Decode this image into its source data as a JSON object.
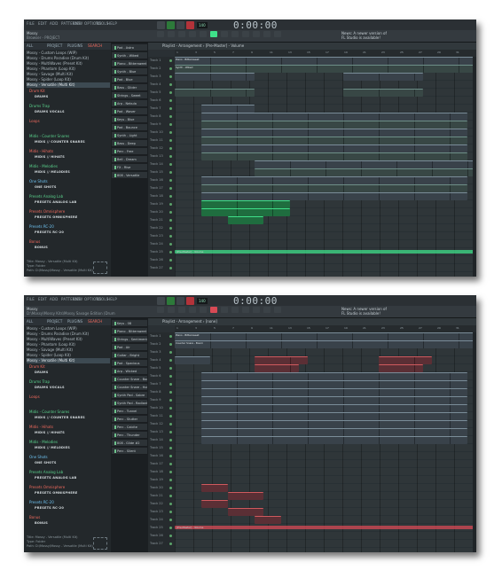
{
  "screenshots": [
    {
      "menu": [
        "FILE",
        "EDIT",
        "ADD",
        "PATTERNS",
        "VIEW",
        "OPTIONS",
        "TOOLS",
        "HELP"
      ],
      "title": "Mossy",
      "subtitle": "Browser - PROJECT",
      "time": "0:00:00",
      "pattern_selector": "Yeah - Starlight",
      "news": [
        "News: A newer version of",
        "FL Studio is available!"
      ],
      "browser_tabs": [
        "ALL",
        "PROJECT",
        "PLUGINS",
        "SEARCH"
      ],
      "files": [
        "Mossy - Custom Loops (WIP)",
        "Mossy - Drums Paradise (Drum Kit)",
        "Mossy - MultiWaves (Preset Kit)",
        "Mossy - Phantom (Loop Kit)",
        "Mossy - Savage (Multi Kit)",
        "Mossy - Spider (Loop Kit)",
        "Mossy - Versatile (Multi Kit)"
      ],
      "folders": [
        {
          "name": "Drum Kit",
          "tag": "DRUMS"
        },
        {
          "name": "Drums Trap",
          "tag": "DRUMS VOCALS"
        },
        {
          "name": "Loops",
          "tag": ""
        },
        {
          "name": "Midis - Counter Snares",
          "tag": "MIDIS // COUNTER SNARES"
        },
        {
          "name": "Midis - Hihats",
          "tag": "MIDIS // HIHATS"
        },
        {
          "name": "Midis - Melodies",
          "tag": "MIDIS // MELODIES"
        },
        {
          "name": "One Shots",
          "tag": "ONE SHOTS"
        },
        {
          "name": "Presets Analog Lab",
          "tag": "PRESETS ANALOG LAB"
        },
        {
          "name": "Presets Omnisphere",
          "tag": "PRESETS OMNISPHERE"
        },
        {
          "name": "Presets RC-20",
          "tag": "PRESETS RC-20"
        },
        {
          "name": "Bonus",
          "tag": "BONUS"
        }
      ],
      "info": [
        "Title: Mossy - Versatile (Multi Kit)",
        "Type: Folder",
        "Path: D:\\Mossy\\Mossy - Versatile (Multi Kit)"
      ],
      "channels": [
        "Pad - Astro",
        "Synth - Wiked",
        "Piano - Bittersweet",
        "Synth - Blue",
        "Pad - Blue",
        "Bass - Glider",
        "Strings - Sweet",
        "Arp - Nebula",
        "Pad - Waver",
        "Keys - Blue",
        "Pad - Bounce",
        "Synth - Light",
        "Bass - Deep",
        "Perc - Free",
        "Bell - Dream",
        "FX - Rise",
        "808 - Versatile"
      ],
      "playlist_title": "Playlist - Arrangement › [Pre-Master] - Volume",
      "ticks": [
        "1",
        "3",
        "5",
        "7",
        "9",
        "11",
        "13",
        "15",
        "17",
        "19",
        "21",
        "23",
        "25",
        "27",
        "29",
        "31"
      ],
      "tracks": [
        "Track 1",
        "Track 2",
        "Track 3",
        "Track 4",
        "Track 5",
        "Track 6",
        "Track 7",
        "Track 8",
        "Track 9",
        "Track 10",
        "Track 11",
        "Track 12",
        "Track 13",
        "Track 14",
        "Track 15",
        "Track 16",
        "Track 17",
        "Track 18",
        "Track 19",
        "Track 20",
        "Track 21",
        "Track 22",
        "Track 23",
        "Track 24",
        "Track 25",
        "Track 26",
        "Track 27"
      ],
      "clip_label_a": "Piano - Bittersweet",
      "clip_label_b": "Synth - Wiked",
      "automation_label": "[Pre-Master] - Volume",
      "accent": "#3fe08a"
    },
    {
      "menu": [
        "FILE",
        "EDIT",
        "ADD",
        "PATTERNS",
        "VIEW",
        "OPTIONS",
        "TOOLS",
        "HELP"
      ],
      "title": "Mossy",
      "subtitle": "D:\\Mossy\\Mossy Kits\\Mossy Savage Edition (Drum Kit)",
      "time": "0:00:00",
      "pattern_selector": "808 - Glide #2",
      "news": [
        "News: A newer version of",
        "FL Studio is available!"
      ],
      "browser_tabs": [
        "ALL",
        "PROJECT",
        "PLUGINS",
        "SEARCH"
      ],
      "files": [
        "Mossy - Custom Loops (WIP)",
        "Mossy - Drums Paradise (Drum Kit)",
        "Mossy - MultiWaves (Preset Kit)",
        "Mossy - Phantom (Loop Kit)",
        "Mossy - Savage (Multi Kit)",
        "Mossy - Spider (Loop Kit)",
        "Mossy - Versatile (Multi Kit)"
      ],
      "folders": [
        {
          "name": "Drum Kit",
          "tag": "DRUMS"
        },
        {
          "name": "Drums Trap",
          "tag": "DRUMS VOCALS"
        },
        {
          "name": "Loops",
          "tag": ""
        },
        {
          "name": "Midis - Counter Snares",
          "tag": "MIDIS // COUNTER SNARES"
        },
        {
          "name": "Midis - Hihats",
          "tag": "MIDIS // HIHATS"
        },
        {
          "name": "Midis - Melodies",
          "tag": "MIDIS // MELODIES"
        },
        {
          "name": "One Shots",
          "tag": "ONE SHOTS"
        },
        {
          "name": "Presets Analog Lab",
          "tag": "PRESETS ANALOG LAB"
        },
        {
          "name": "Presets Omnisphere",
          "tag": "PRESETS OMNISPHERE"
        },
        {
          "name": "Presets RC-20",
          "tag": "PRESETS RC-20"
        },
        {
          "name": "Bonus",
          "tag": "BONUS"
        }
      ],
      "info": [
        "Title: Mossy - Versatile (Multi Kit)",
        "Type: Folder",
        "Path: D:\\Mossy\\Mossy - Versatile (Multi Kit)"
      ],
      "channels": [
        "Keys - 08",
        "Piano - Bittersweet",
        "Strings - Sentiment",
        "Pad - Air",
        "Guitar - Bright",
        "Pad - Spacious",
        "Arp - Wicked",
        "Counter Snare - Boom",
        "Counter Snare - Hollow",
        "Synth Pad - Sabre",
        "Synth Pad - Radiant",
        "Perc - Tunnel",
        "Perc - Stutter",
        "Perc - Calcite",
        "Perc - Thunder",
        "808 - Glide #2",
        "Perc - Silent"
      ],
      "playlist_title": "Playlist - Arrangement › [none]",
      "ticks": [
        "1",
        "3",
        "5",
        "7",
        "9",
        "11",
        "13",
        "15",
        "17",
        "19",
        "21",
        "23",
        "25",
        "27",
        "29",
        "31"
      ],
      "tracks": [
        "Track 1",
        "Track 2",
        "Track 3",
        "Track 4",
        "Track 5",
        "Track 6",
        "Track 7",
        "Track 8",
        "Track 9",
        "Track 10",
        "Track 11",
        "Track 12",
        "Track 13",
        "Track 14",
        "Track 15",
        "Track 16",
        "Track 17",
        "Track 18",
        "Track 19",
        "Track 20",
        "Track 21",
        "Track 22",
        "Track 23",
        "Track 24",
        "Track 25",
        "Track 26",
        "Track 27"
      ],
      "clip_label_a": "Piano - Bittersweet",
      "clip_label_b": "Counter Snare - Boom",
      "automation_label": "[Pre-Master] - Volume",
      "accent": "#d84a55"
    }
  ]
}
